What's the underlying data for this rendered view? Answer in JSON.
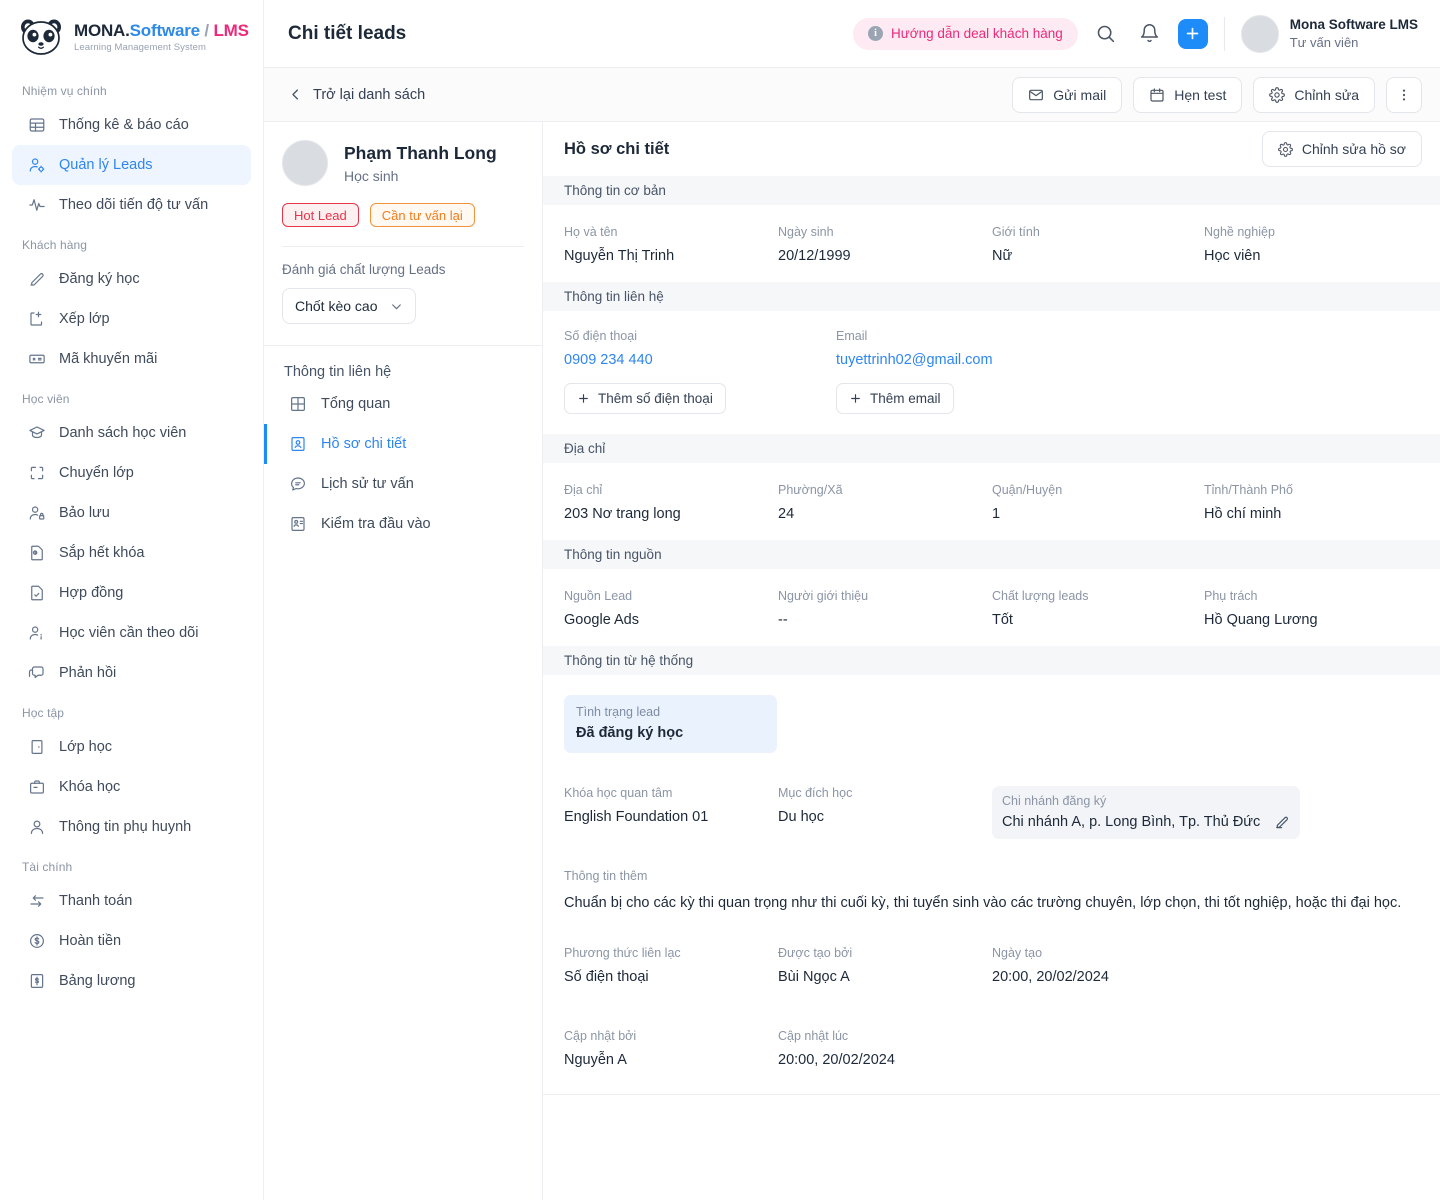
{
  "brand": {
    "title_mona": "MONA.",
    "title_software": "Software",
    "title_slash": "/",
    "title_lms": "LMS",
    "subtitle": "Learning Management System"
  },
  "sidebar": {
    "groups": [
      {
        "label": "Nhiệm vụ chính",
        "items": [
          {
            "label": "Thống kê & báo cáo",
            "icon": "table-icon",
            "active": false
          },
          {
            "label": "Quản lý Leads",
            "icon": "user-settings-icon",
            "active": true
          },
          {
            "label": "Theo dõi tiến độ tư vấn",
            "icon": "activity-icon",
            "active": false
          }
        ]
      },
      {
        "label": "Khách hàng",
        "items": [
          {
            "label": "Đăng ký học",
            "icon": "pencil-icon",
            "active": false
          },
          {
            "label": "Xếp lớp",
            "icon": "file-plus-icon",
            "active": false
          },
          {
            "label": "Mã khuyến mãi",
            "icon": "ticket-icon",
            "active": false
          }
        ]
      },
      {
        "label": "Học viên",
        "items": [
          {
            "label": "Danh sách học viên",
            "icon": "graduation-cap-icon",
            "active": false
          },
          {
            "label": "Chuyển lớp",
            "icon": "transfer-icon",
            "active": false
          },
          {
            "label": "Bảo lưu",
            "icon": "user-lock-icon",
            "active": false
          },
          {
            "label": "Sắp hết khóa",
            "icon": "file-clock-icon",
            "active": false
          },
          {
            "label": "Hợp đồng",
            "icon": "contract-icon",
            "active": false
          },
          {
            "label": "Học viên cần theo dõi",
            "icon": "user-info-icon",
            "active": false
          },
          {
            "label": "Phản hồi",
            "icon": "chat-icon",
            "active": false
          }
        ]
      },
      {
        "label": "Học tập",
        "items": [
          {
            "label": "Lớp học",
            "icon": "door-icon",
            "active": false
          },
          {
            "label": "Khóa học",
            "icon": "briefcase-icon",
            "active": false
          },
          {
            "label": "Thông tin phụ huynh",
            "icon": "user-icon",
            "active": false
          }
        ]
      },
      {
        "label": "Tài chính",
        "items": [
          {
            "label": "Thanh toán",
            "icon": "exchange-icon",
            "active": false
          },
          {
            "label": "Hoàn tiền",
            "icon": "refund-icon",
            "active": false
          },
          {
            "label": "Bảng lương",
            "icon": "payroll-icon",
            "active": false
          }
        ]
      }
    ]
  },
  "topbar": {
    "page_title": "Chi tiết leads",
    "promo_label": "Hướng dẫn deal khách hàng",
    "search_icon": "search-icon",
    "bell_icon": "bell-icon",
    "plus_icon": "plus-icon",
    "user_name": "Mona Software LMS",
    "user_role": "Tư vấn viên"
  },
  "actionbar": {
    "back_label": "Trở lại danh sách",
    "buttons": [
      {
        "label": "Gửi mail",
        "icon": "mail-icon"
      },
      {
        "label": "Hẹn test",
        "icon": "calendar-icon"
      },
      {
        "label": "Chỉnh sửa",
        "icon": "gear-icon"
      }
    ],
    "more_icon": "more-vertical-icon"
  },
  "lead_panel": {
    "name": "Phạm Thanh Long",
    "role": "Học sinh",
    "tags": [
      {
        "label": "Hot Lead",
        "type": "hot"
      },
      {
        "label": "Cần tư vấn lại",
        "type": "warn"
      }
    ],
    "quality_label": "Đánh giá chất lượng Leads",
    "quality_value": "Chốt kèo cao",
    "subnav_label": "Thông tin liên hệ",
    "subnav": [
      {
        "label": "Tổng quan",
        "icon": "grid-icon",
        "active": false
      },
      {
        "label": "Hồ sơ chi tiết",
        "icon": "id-card-icon",
        "active": true
      },
      {
        "label": "Lịch sử tư vấn",
        "icon": "message-icon",
        "active": false
      },
      {
        "label": "Kiểm tra đầu vào",
        "icon": "test-icon",
        "active": false
      }
    ]
  },
  "detail": {
    "title": "Hồ sơ chi tiết",
    "edit_button": "Chỉnh sửa hồ sơ",
    "sections": {
      "basic": {
        "header": "Thông tin cơ bản",
        "fields": [
          {
            "label": "Họ và tên",
            "value": "Nguyễn Thị Trinh"
          },
          {
            "label": "Ngày sinh",
            "value": "20/12/1999"
          },
          {
            "label": "Giới tính",
            "value": "Nữ"
          },
          {
            "label": "Nghề nghiệp",
            "value": "Học viên"
          }
        ]
      },
      "contact": {
        "header": "Thông tin liên hệ",
        "phone_label": "Số điện thoại",
        "phone_value": "0909 234 440",
        "phone_add": "Thêm số điện thoại",
        "email_label": "Email",
        "email_value": "tuyettrinh02@gmail.com",
        "email_add": "Thêm email"
      },
      "address": {
        "header": "Địa chỉ",
        "fields": [
          {
            "label": "Địa chỉ",
            "value": "203 Nơ trang long"
          },
          {
            "label": "Phường/Xã",
            "value": "24"
          },
          {
            "label": "Quận/Huyện",
            "value": "1"
          },
          {
            "label": "Tỉnh/Thành Phố",
            "value": "Hồ chí minh"
          }
        ]
      },
      "source": {
        "header": "Thông tin nguồn",
        "fields": [
          {
            "label": "Nguồn Lead",
            "value": "Google Ads"
          },
          {
            "label": "Người giới thiệu",
            "value": "--"
          },
          {
            "label": "Chất lượng leads",
            "value": "Tốt"
          },
          {
            "label": "Phụ trách",
            "value": "Hồ Quang Lương"
          }
        ]
      },
      "system": {
        "header": "Thông tin từ hệ thống",
        "status_label": "Tình trạng lead",
        "status_value": "Đã đăng ký học",
        "course_label": "Khóa học quan tâm",
        "course_value": "English Foundation 01",
        "purpose_label": "Mục đích học",
        "purpose_value": "Du học",
        "branch_label": "Chi nhánh đăng ký",
        "branch_value": "Chi nhánh A, p. Long Bình, Tp. Thủ Đức",
        "branch_edit_icon": "pencil-icon",
        "extra_label": "Thông tin thêm",
        "extra_value": "Chuẩn bị cho các kỳ thi quan trọng như thi cuối kỳ, thi tuyển sinh vào các trường chuyên, lớp chọn, thi tốt nghiệp, hoặc thi đại học.",
        "contact_method_label": "Phương thức liên lạc",
        "contact_method_value": "Số điện thoại",
        "created_by_label": "Được tạo bởi",
        "created_by_value": "Bùi Ngọc A",
        "created_at_label": "Ngày tạo",
        "created_at_value": "20:00, 20/02/2024",
        "updated_by_label": "Cập nhật bởi",
        "updated_by_value": "Nguyễn A",
        "updated_at_label": "Cập nhật lúc",
        "updated_at_value": "20:00, 20/02/2024"
      }
    }
  },
  "colors": {
    "accent_blue": "#1d8cf8",
    "brand_pink": "#ec2a7b",
    "brand_blue": "#2e8ae6",
    "hot_red": "#e8344a",
    "warn_orange": "#f07c1b",
    "status_bg": "#eaf2fd"
  }
}
